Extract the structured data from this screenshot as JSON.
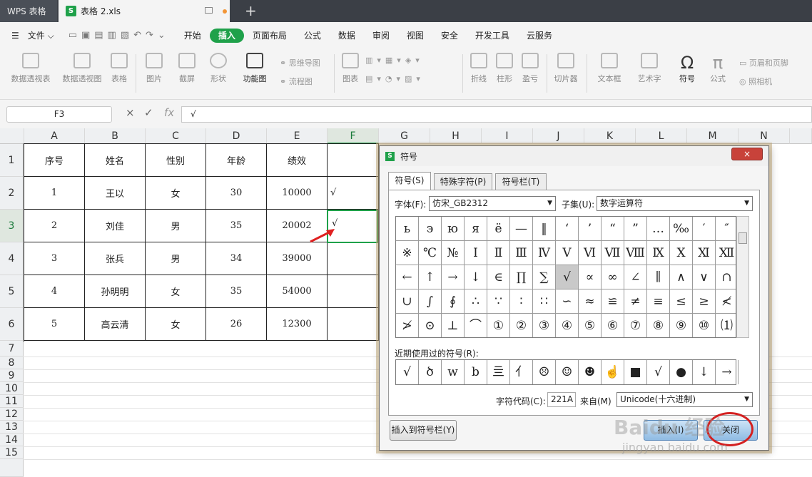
{
  "titlebar": {
    "app": "WPS 表格",
    "file": "表格 2.xls",
    "new_tab": "+"
  },
  "menubar": {
    "file": "文件",
    "items": [
      "开始",
      "插入",
      "页面布局",
      "公式",
      "数据",
      "审阅",
      "视图",
      "安全",
      "开发工具",
      "云服务"
    ],
    "active": "插入"
  },
  "ribbon": {
    "pivot": "数据透视表",
    "pivot_chart": "数据透视图",
    "table": "表格",
    "picture": "图片",
    "screenshot": "截屏",
    "shape": "形状",
    "function_chart": "功能图",
    "mindmap": "思维导图",
    "flowchart": "流程图",
    "chart": "图表",
    "line": "折线",
    "bar": "柱形",
    "winloss": "盈亏",
    "slicer": "切片器",
    "textbox": "文本框",
    "wordart": "艺术字",
    "symbol": "符号",
    "formula": "公式",
    "header_footer": "页眉和页脚",
    "camera": "照相机"
  },
  "formulabar": {
    "namebox": "F3",
    "cancel": "×",
    "confirm": "✓",
    "fx": "fx",
    "value": "√"
  },
  "sheet": {
    "columns": [
      "A",
      "B",
      "C",
      "D",
      "E",
      "F",
      "G",
      "H",
      "I",
      "J",
      "K",
      "L",
      "M",
      "N"
    ],
    "rows": [
      "1",
      "2",
      "3",
      "4",
      "5",
      "6",
      "7",
      "8",
      "9",
      "10",
      "11",
      "12",
      "13",
      "14",
      "15"
    ],
    "headers": [
      "序号",
      "姓名",
      "性别",
      "年龄",
      "绩效"
    ],
    "data": [
      [
        "1",
        "王以",
        "女",
        "30",
        "10000"
      ],
      [
        "2",
        "刘佳",
        "男",
        "35",
        "20002"
      ],
      [
        "3",
        "张兵",
        "男",
        "34",
        "39000"
      ],
      [
        "4",
        "孙明明",
        "女",
        "35",
        "54000"
      ],
      [
        "5",
        "高云清",
        "女",
        "26",
        "12300"
      ]
    ],
    "f2": "√",
    "f3": "√"
  },
  "dialog": {
    "title": "符号",
    "close": "×",
    "tabs": [
      "符号(S)",
      "特殊字符(P)",
      "符号栏(T)"
    ],
    "font_label": "字体(F):",
    "font_value": "仿宋_GB2312",
    "subset_label": "子集(U):",
    "subset_value": "数字运算符",
    "symbols": [
      [
        "ь",
        "э",
        "ю",
        "я",
        "ё",
        "—",
        "‖",
        "‘",
        "’",
        "“",
        "”",
        "…",
        "‰",
        "′",
        "″"
      ],
      [
        "※",
        "℃",
        "№",
        "Ⅰ",
        "Ⅱ",
        "Ⅲ",
        "Ⅳ",
        "Ⅴ",
        "Ⅵ",
        "Ⅶ",
        "Ⅷ",
        "Ⅸ",
        "Ⅹ",
        "Ⅺ",
        "Ⅻ"
      ],
      [
        "←",
        "↑",
        "→",
        "↓",
        "∈",
        "∏",
        "∑",
        "√",
        "∝",
        "∞",
        "∠",
        "∥",
        "∧",
        "∨",
        "∩"
      ],
      [
        "∪",
        "∫",
        "∮",
        "∴",
        "∵",
        "∶",
        "∷",
        "∽",
        "≈",
        "≌",
        "≠",
        "≡",
        "≤",
        "≥",
        "≮"
      ],
      [
        "≯",
        "⊙",
        "⊥",
        "⌒",
        "①",
        "②",
        "③",
        "④",
        "⑤",
        "⑥",
        "⑦",
        "⑧",
        "⑨",
        "⑩",
        "⑴"
      ]
    ],
    "recent_label": "近期使用过的符号(R):",
    "recent": [
      "√",
      "ծ",
      "w",
      "b",
      "亖",
      "亻",
      "☹",
      "☺",
      "☻",
      "☝",
      "■",
      "√",
      "●",
      "↓",
      "→"
    ],
    "code_label": "字符代码(C):",
    "code_value": "221A",
    "from_label": "来自(M)",
    "from_value": "Unicode(十六进制)",
    "insert_to_bar": "插入到符号栏(Y)",
    "insert": "插入(I)",
    "close_btn": "关闭"
  },
  "watermark": {
    "logo": "Baidu 经验",
    "url": "jingyan.baidu.com"
  }
}
